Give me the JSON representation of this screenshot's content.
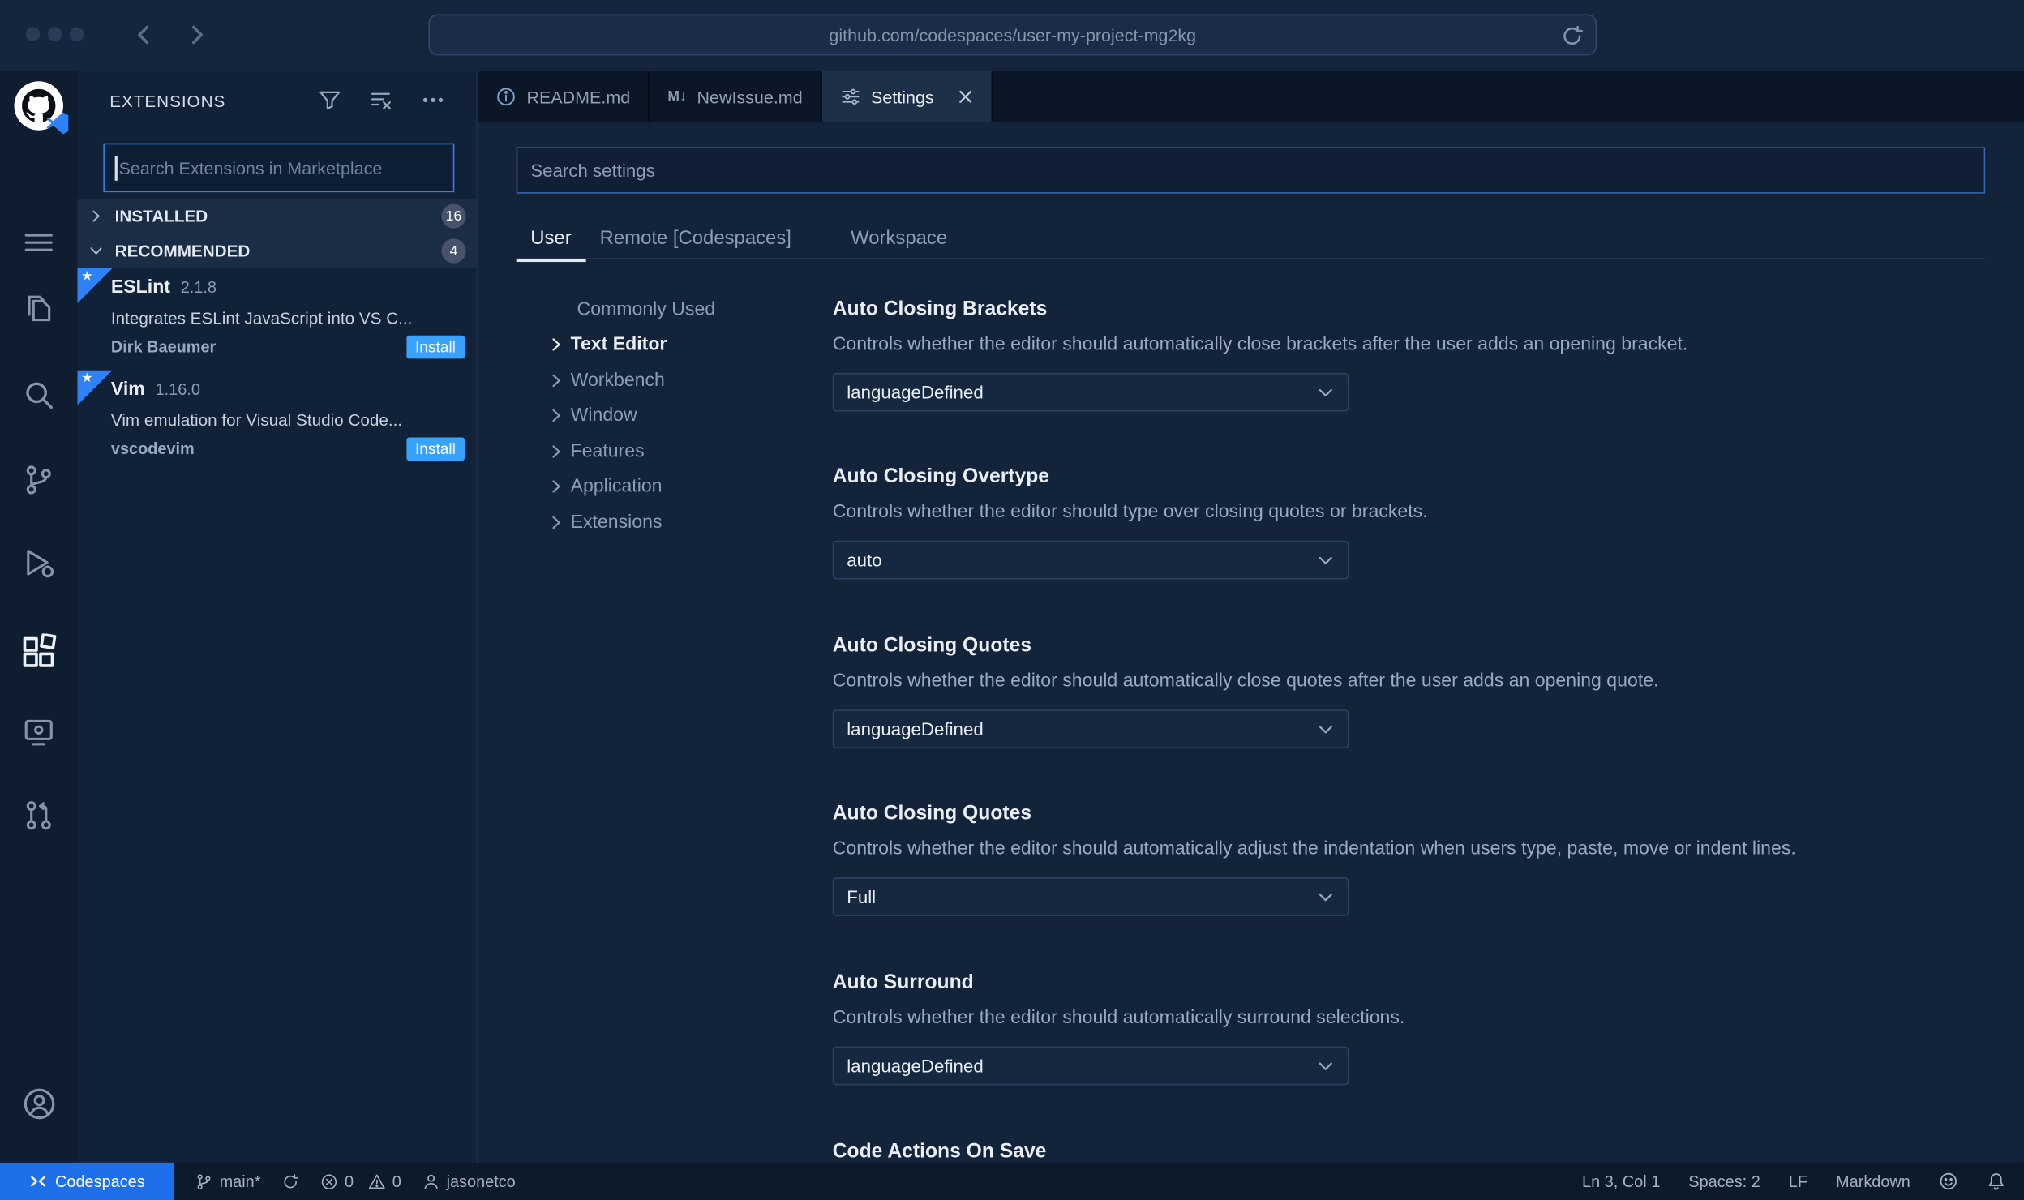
{
  "browser": {
    "url": "github.com/codespaces/user-my-project-mg2kg"
  },
  "glyphs": {
    "star": "★",
    "markdown": "M↓"
  },
  "activity_bar": {
    "icons": [
      "menu",
      "explorer",
      "search",
      "source-control",
      "run-and-debug",
      "extensions",
      "remote-explorer",
      "github-pull-requests",
      "account",
      "settings-gear"
    ],
    "active": "extensions"
  },
  "sidebar": {
    "title": "EXTENSIONS",
    "header_icons": [
      "filter",
      "clear-search-results",
      "more-actions"
    ],
    "search": {
      "placeholder": "Search Extensions in Marketplace",
      "value": ""
    },
    "sections": [
      {
        "label": "INSTALLED",
        "badge": "16",
        "expanded": false
      },
      {
        "label": "RECOMMENDED",
        "badge": "4",
        "expanded": true
      }
    ],
    "extensions": [
      {
        "name": "ESLint",
        "version": "2.1.8",
        "description": "Integrates ESLint JavaScript into VS C...",
        "author": "Dirk Baeumer",
        "action": "Install"
      },
      {
        "name": "Vim",
        "version": "1.16.0",
        "description": "Vim emulation for Visual Studio Code...",
        "author": "vscodevim",
        "action": "Install"
      }
    ]
  },
  "editor": {
    "tabs": [
      {
        "label": "README.md",
        "icon": "info-icon",
        "active": false
      },
      {
        "label": "NewIssue.md",
        "icon": "markdown-icon",
        "active": false
      },
      {
        "label": "Settings",
        "icon": "tune-icon",
        "active": true,
        "closable": true
      }
    ]
  },
  "settings_editor": {
    "search": {
      "placeholder": "Search settings",
      "value": ""
    },
    "scope_tabs": [
      {
        "label": "User",
        "active": true
      },
      {
        "label": "Remote [Codespaces]",
        "active": false
      },
      {
        "label": "Workspace",
        "active": false
      }
    ],
    "toc": [
      {
        "label": "Commonly Used",
        "active": false
      },
      {
        "label": "Text Editor",
        "active": true
      },
      {
        "label": "Workbench",
        "active": false
      },
      {
        "label": "Window",
        "active": false
      },
      {
        "label": "Features",
        "active": false
      },
      {
        "label": "Application",
        "active": false
      },
      {
        "label": "Extensions",
        "active": false
      }
    ],
    "items": [
      {
        "title": "Auto Closing Brackets",
        "description": "Controls whether the editor should automatically close brackets after the user adds an opening bracket.",
        "value": "languageDefined"
      },
      {
        "title": "Auto Closing Overtype",
        "description": "Controls whether the editor should type over closing quotes or brackets.",
        "value": "auto"
      },
      {
        "title": "Auto Closing Quotes",
        "description": "Controls whether the editor should automatically close quotes after the user adds an opening quote.",
        "value": "languageDefined"
      },
      {
        "title": "Auto Closing Quotes",
        "description": "Controls whether the editor should automatically adjust the indentation when users type, paste, move or indent lines.",
        "value": "Full"
      },
      {
        "title": "Auto Surround",
        "description": "Controls whether the editor should automatically surround selections.",
        "value": "languageDefined"
      },
      {
        "title": "Code Actions On Save",
        "description": "",
        "value": ""
      }
    ]
  },
  "status_bar": {
    "codespaces_label": "Codespaces",
    "branch": "main*",
    "errors": "0",
    "warnings": "0",
    "user": "jasonetco",
    "cursor": "Ln 3, Col 1",
    "indent": "Spaces: 2",
    "eol": "LF",
    "language": "Markdown"
  },
  "colors": {
    "accent_blue": "#2f81f7",
    "install_blue": "#38a3ff",
    "statusbar_blue": "#1f6feb"
  }
}
